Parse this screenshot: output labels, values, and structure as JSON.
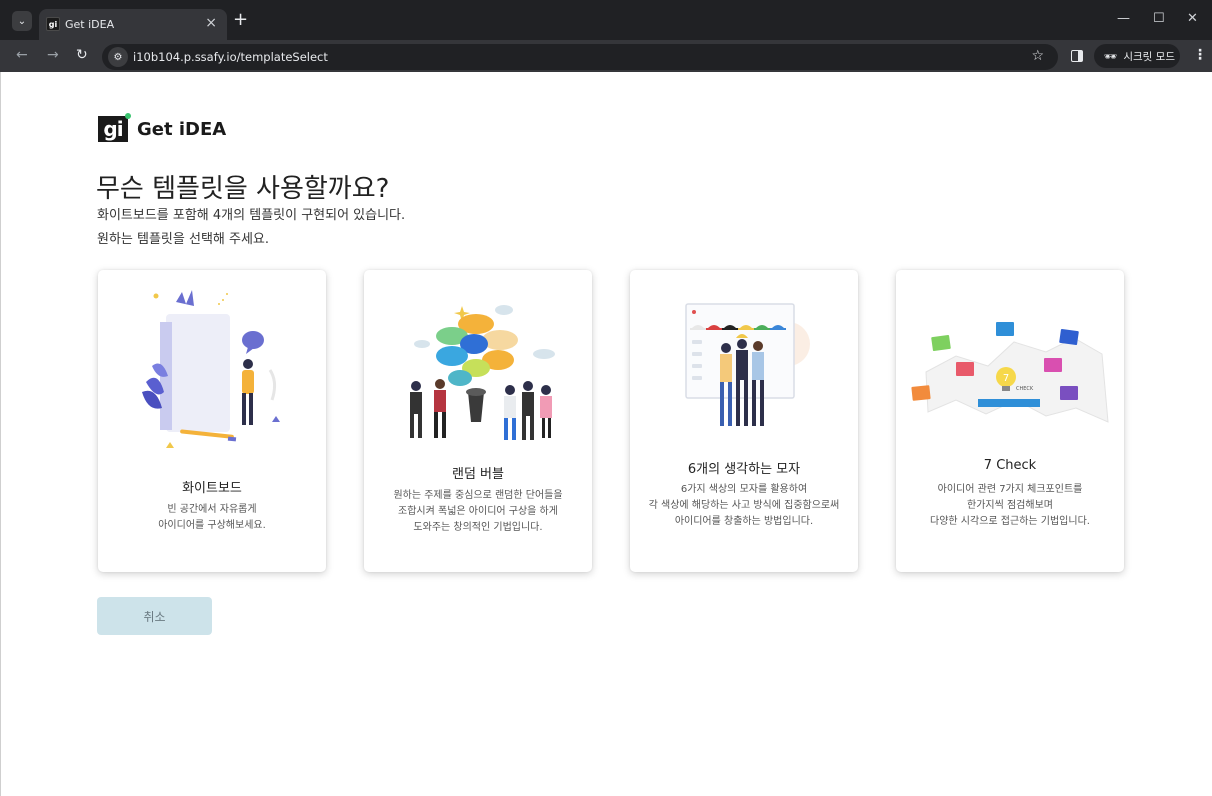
{
  "browser": {
    "tab_title": "Get iDEA",
    "tab_favicon": "gi",
    "url": "i10b104.p.ssafy.io/templateSelect",
    "incognito_label": "시크릿 모드",
    "icons": [
      "tab-search-icon",
      "close-icon",
      "plus-icon",
      "minimize-icon",
      "maximize-icon",
      "window-close-icon",
      "back-icon",
      "forward-icon",
      "reload-icon",
      "site-info-icon",
      "star-icon",
      "side-panel-icon",
      "incognito-icon",
      "kebab-menu-icon"
    ]
  },
  "logo": {
    "mark": "gi",
    "text": "Get iDEA"
  },
  "page": {
    "heading": "무슨 템플릿을 사용할까요?",
    "subtitle_line1": "화이트보드를 포함해 4개의 템플릿이 구현되어 있습니다.",
    "subtitle_line2": "원하는 템플릿을 선택해 주세요."
  },
  "templates": [
    {
      "title": "화이트보드",
      "description": "빈 공간에서 자유롭게\n아이디어를 구상해보세요."
    },
    {
      "title": "랜덤 버블",
      "description": "원하는 주제를 중심으로 랜덤한 단어들을\n조합시켜 폭넓은 아이디어 구상을 하게\n도와주는 창의적인 기법입니다."
    },
    {
      "title": "6개의 생각하는 모자",
      "description": "6가지 색상의 모자를 활용하여\n각 색상에 해당하는 사고 방식에 집중함으로써\n아이디어를 창출하는 방법입니다."
    },
    {
      "title": "7 Check",
      "description": "아이디어 관련 7가지 체크포인트를\n한가지씩 점검해보며\n다양한 시각으로 접근하는 기법입니다."
    }
  ],
  "illus7": {
    "center_label": "7",
    "check_label": "CHECK"
  },
  "cancel_label": "취소",
  "colors": {
    "accent_button": "#cde3ea",
    "chrome_dark": "#202124"
  }
}
